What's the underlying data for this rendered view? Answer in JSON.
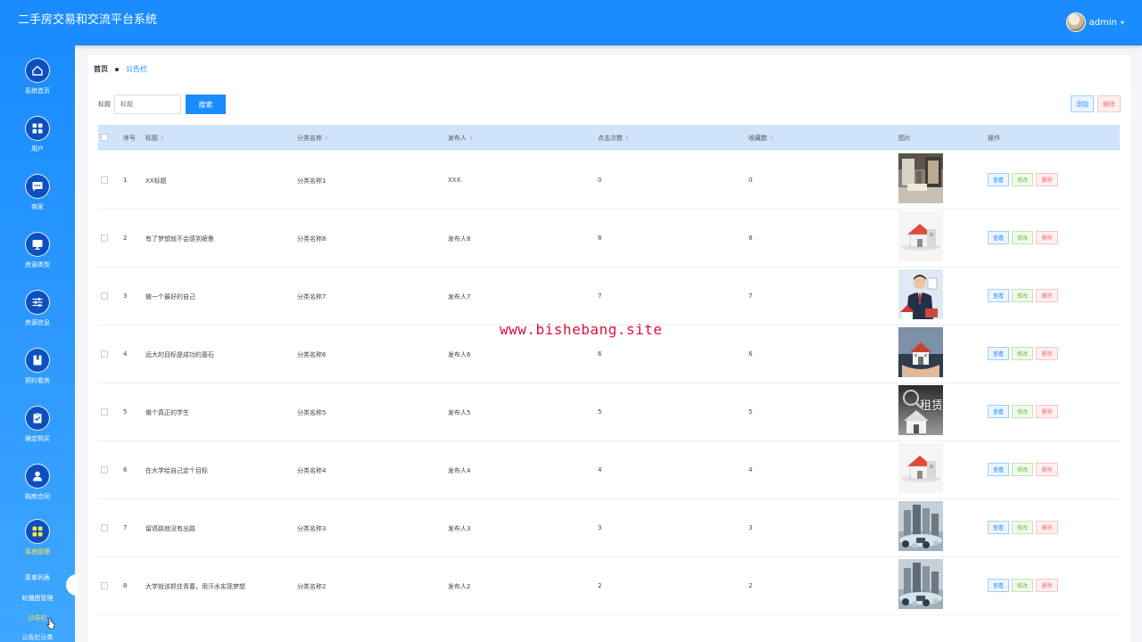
{
  "app": {
    "title": "二手房交易和交流平台系统"
  },
  "user": {
    "name": "admin",
    "caret": "▾"
  },
  "sidebar": {
    "items": [
      {
        "label": "系统首页",
        "icon": "home-icon"
      },
      {
        "label": "用户",
        "icon": "grid-icon"
      },
      {
        "label": "商家",
        "icon": "chat-icon"
      },
      {
        "label": "房源类型",
        "icon": "monitor-icon"
      },
      {
        "label": "房源信息",
        "icon": "sliders-icon"
      },
      {
        "label": "预约看房",
        "icon": "book-icon"
      },
      {
        "label": "确定购买",
        "icon": "clipboard-check-icon"
      },
      {
        "label": "购房合同",
        "icon": "user-icon"
      },
      {
        "label": "系统管理",
        "icon": "grid-icon"
      }
    ],
    "sub_items": [
      "菜单列表",
      "轮播图管理",
      "公告栏",
      "公告栏分类"
    ],
    "active_item": "系统管理",
    "active_sub": "公告栏"
  },
  "breadcrumb": {
    "home": "首页",
    "current": "公告栏"
  },
  "search": {
    "label": "标题",
    "placeholder": "标题",
    "button": "搜索"
  },
  "actions": {
    "add": "添加",
    "delete": "删除"
  },
  "table": {
    "headers": [
      "序号",
      "标题",
      "分类名称",
      "发布人",
      "点击次数",
      "收藏数",
      "图片",
      "操作"
    ],
    "op_labels": {
      "view": "查看",
      "edit": "修改",
      "delete": "删除"
    },
    "rows": [
      {
        "index": "1",
        "title": "XX标题",
        "category": "分类名称1",
        "publisher": "XXX",
        "clicks": "0",
        "favorites": "0",
        "image": "interior"
      },
      {
        "index": "2",
        "title": "有了梦想就不会感到疲惫",
        "category": "分类名称8",
        "publisher": "发布人8",
        "clicks": "8",
        "favorites": "8",
        "image": "house-model"
      },
      {
        "index": "3",
        "title": "做一个最好的自己",
        "category": "分类名称7",
        "publisher": "发布人7",
        "clicks": "7",
        "favorites": "7",
        "image": "agent"
      },
      {
        "index": "4",
        "title": "远大的目标是成功的基石",
        "category": "分类名称6",
        "publisher": "发布人6",
        "clicks": "6",
        "favorites": "6",
        "image": "house-in-hands"
      },
      {
        "index": "5",
        "title": "做个真正的学生",
        "category": "分类名称5",
        "publisher": "发布人5",
        "clicks": "5",
        "favorites": "5",
        "image": "rent",
        "image_text": "租赁"
      },
      {
        "index": "6",
        "title": "在大学给自己定个目标",
        "category": "分类名称4",
        "publisher": "发布人4",
        "clicks": "4",
        "favorites": "4",
        "image": "house-model"
      },
      {
        "index": "7",
        "title": "留退路就没有出路",
        "category": "分类名称3",
        "publisher": "发布人3",
        "clicks": "3",
        "favorites": "3",
        "image": "buildings"
      },
      {
        "index": "8",
        "title": "大学就该抓住青春，用汗水实现梦想",
        "category": "分类名称2",
        "publisher": "发布人2",
        "clicks": "2",
        "favorites": "2",
        "image": "buildings"
      }
    ]
  },
  "watermark": "www.bishebang.site",
  "colors": {
    "primary": "#1a8cff",
    "danger": "#f56c6c",
    "success": "#67c23a",
    "active_nav": "#ffeb3b"
  }
}
